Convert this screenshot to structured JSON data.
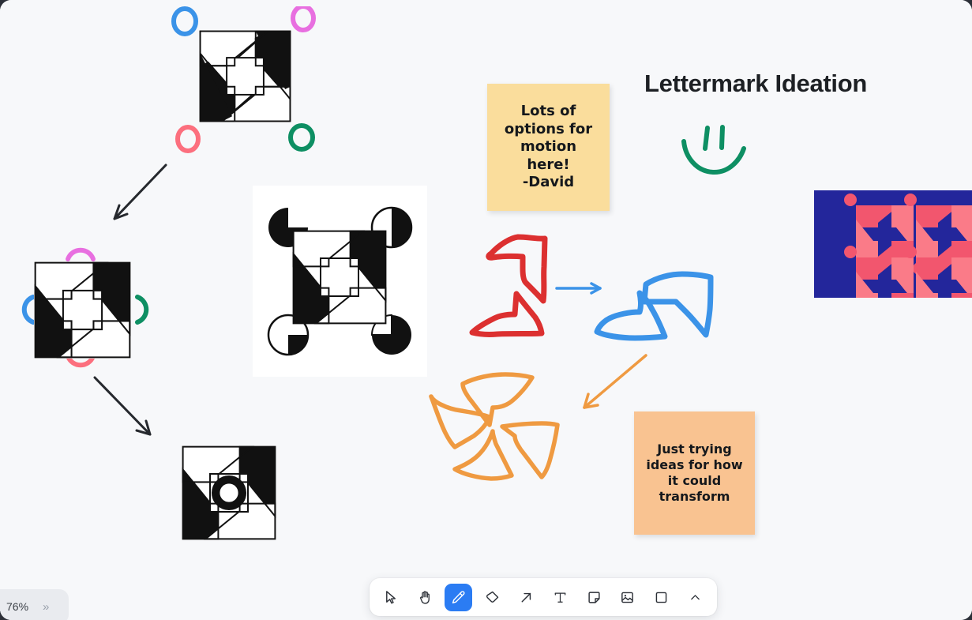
{
  "app": {
    "background": "#f7f8fa",
    "accent": "#2b7cf3"
  },
  "board": {
    "title": "Lettermark Ideation"
  },
  "sticky_notes": [
    {
      "id": "david",
      "text": "Lots of\noptions for\nmotion\nhere!\n-David",
      "color": "#fadd9c"
    },
    {
      "id": "transform",
      "text": "Just trying\nideas for how\nit could\ntransform",
      "color": "#f9c391"
    }
  ],
  "shapes": {
    "logo_variant_corner_circles": "logo-corner-circles",
    "logo_variant_edge_arcs": "logo-edge-arcs",
    "logo_variant_center_ring": "logo-center-ring",
    "logo_variant_pacman_corners": "logo-pacman-corners",
    "sketch_red_quarter": "red-sketch-quarter",
    "sketch_blue_quarter": "blue-sketch-quarter",
    "sketch_orange_pinwheel": "orange-sketch-pinwheel",
    "sketch_green_smiley": "green-smiley-sketch"
  },
  "colors": {
    "pen_blue": "#3b93e8",
    "pen_magenta": "#e86fe0",
    "pen_pink": "#fc6f7e",
    "pen_green": "#0e8f63",
    "pen_red": "#dc3030",
    "pen_orange": "#ef9a41",
    "navy_card": "#23269b",
    "navy_card_mark": "#f2566e",
    "navy_card_mark_light": "#fa7b88",
    "arrow_black": "#26292e"
  },
  "toolbar": {
    "tools": [
      {
        "name": "select-tool",
        "label": "Select",
        "icon": "cursor-icon",
        "active": false
      },
      {
        "name": "hand-tool",
        "label": "Hand",
        "icon": "hand-icon",
        "active": false
      },
      {
        "name": "draw-tool",
        "label": "Draw",
        "icon": "pencil-icon",
        "active": true
      },
      {
        "name": "eraser-tool",
        "label": "Eraser",
        "icon": "eraser-icon",
        "active": false
      },
      {
        "name": "arrow-tool",
        "label": "Arrow",
        "icon": "arrow-icon",
        "active": false
      },
      {
        "name": "text-tool",
        "label": "Text",
        "icon": "text-icon",
        "active": false
      },
      {
        "name": "note-tool",
        "label": "Note",
        "icon": "sticky-note-icon",
        "active": false
      },
      {
        "name": "image-tool",
        "label": "Image",
        "icon": "image-icon",
        "active": false
      },
      {
        "name": "rectangle-tool",
        "label": "Rectangle",
        "icon": "square-icon",
        "active": false
      },
      {
        "name": "more-tools",
        "label": "More",
        "icon": "chevron-up-icon",
        "active": false
      }
    ]
  },
  "zoom": {
    "level": "76%",
    "expand_icon": "»"
  }
}
